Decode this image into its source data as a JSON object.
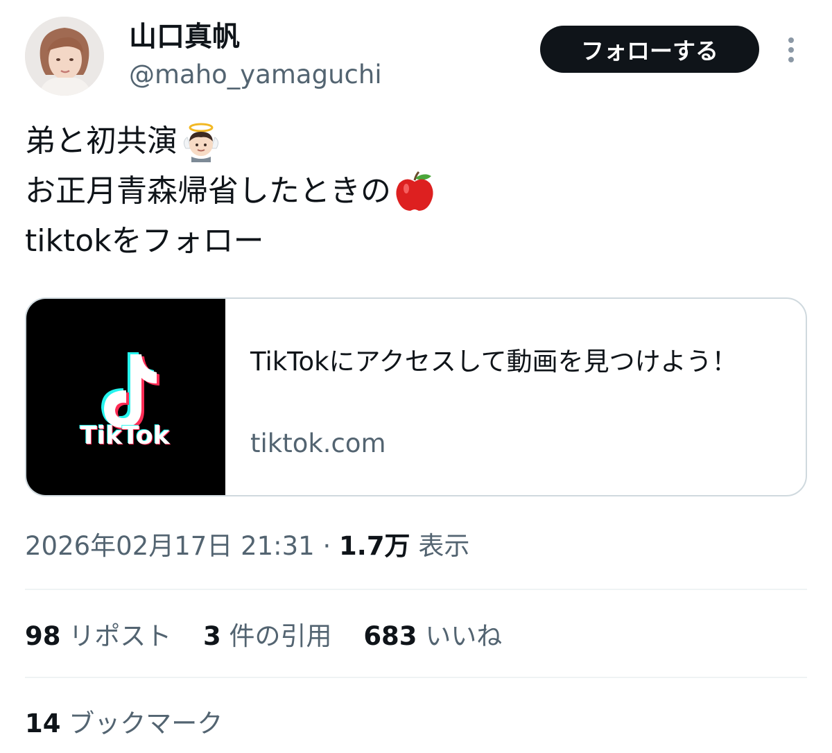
{
  "author": {
    "display_name": "山口真帆",
    "handle": "@maho_yamaguchi"
  },
  "follow_button_label": "フォローする",
  "tweet": {
    "lines": [
      "弟と初共演",
      "お正月青森帰省したときの",
      "tiktokをフォロー"
    ],
    "emojis": [
      "angel-emoji",
      "red-apple-emoji"
    ]
  },
  "card": {
    "logo_text": "TikTok",
    "title": "TikTokにアクセスして動画を見つけよう！",
    "domain": "tiktok.com"
  },
  "meta": {
    "timestamp": "2026年02月17日 21:31",
    "separator": "·",
    "views_count": "1.7万",
    "views_label": "表示"
  },
  "stats": {
    "reposts_count": "98",
    "reposts_label": "リポスト",
    "quotes_count": "3",
    "quotes_label": "件の引用",
    "likes_count": "683",
    "likes_label": "いいね",
    "bookmarks_count": "14",
    "bookmarks_label": "ブックマーク"
  },
  "colors": {
    "text_primary": "#0f1419",
    "text_secondary": "#536471",
    "border": "#cfd9de",
    "divider": "#eff3f4",
    "tiktok_cyan": "#25f4ee",
    "tiktok_pink": "#fe2c55"
  }
}
